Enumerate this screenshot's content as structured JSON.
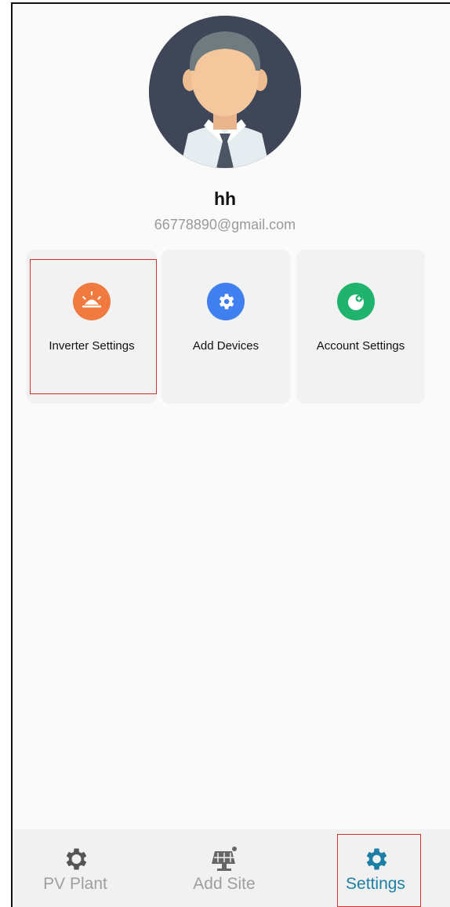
{
  "profile": {
    "name": "hh",
    "email": "66778890@gmail.com"
  },
  "menu": [
    {
      "label": "Inverter Settings",
      "icon": "sunrise-icon",
      "color": "#f07a3f"
    },
    {
      "label": "Add Devices",
      "icon": "gear-icon",
      "color": "#3f7ff0"
    },
    {
      "label": "Account Settings",
      "icon": "account-settings-icon",
      "color": "#1fb36d"
    }
  ],
  "tabs": [
    {
      "label": "PV Plant",
      "icon": "gear-icon",
      "active": false
    },
    {
      "label": "Add Site",
      "icon": "solar-panel-icon",
      "active": false
    },
    {
      "label": "Settings",
      "icon": "gear-icon",
      "active": true
    }
  ],
  "colors": {
    "active_tab": "#1d7fa5",
    "inactive_tab": "#9e9e9e",
    "highlight": "#d0312d"
  }
}
